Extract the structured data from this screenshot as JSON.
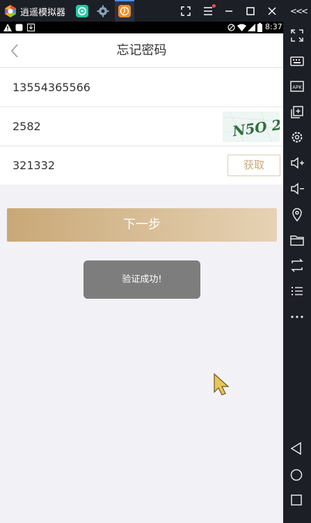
{
  "emulator": {
    "title": "逍遥模拟器",
    "side_icons": [
      "fullscreen-icon",
      "keyboard-icon",
      "apk-icon",
      "add-window-icon",
      "settings-icon",
      "volume-up-icon",
      "volume-down-icon",
      "location-icon",
      "folder-icon",
      "rotate-icon",
      "list-icon",
      "more-icon"
    ],
    "nav_keys": [
      "back-nav-icon",
      "home-nav-icon",
      "recents-nav-icon"
    ],
    "collapse_label": "<<<",
    "apk_label": "APK"
  },
  "status_bar": {
    "time": "8:37"
  },
  "page": {
    "title": "忘记密码",
    "phone_value": "13554365566",
    "captcha_value": "2582",
    "captcha_image_text": "N5O 2",
    "sms_code_value": "321332",
    "get_code_label": "获取",
    "next_label": "下一步",
    "toast_text": "验证成功!"
  },
  "colors": {
    "accent_gold": "#c9a877",
    "accent_gold_light": "#e6d2b4",
    "background": "#f2f1f6",
    "emulator_bg": "#1c1f26"
  }
}
